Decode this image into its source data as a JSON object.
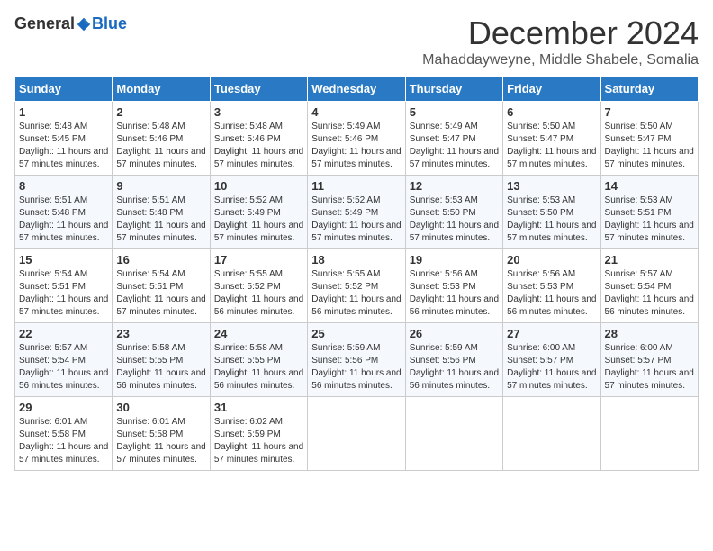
{
  "header": {
    "logo_general": "General",
    "logo_blue": "Blue",
    "month_title": "December 2024",
    "location": "Mahaddayweyne, Middle Shabele, Somalia"
  },
  "weekdays": [
    "Sunday",
    "Monday",
    "Tuesday",
    "Wednesday",
    "Thursday",
    "Friday",
    "Saturday"
  ],
  "weeks": [
    [
      {
        "day": "1",
        "sunrise": "5:48 AM",
        "sunset": "5:45 PM",
        "daylight": "11 hours and 57 minutes"
      },
      {
        "day": "2",
        "sunrise": "5:48 AM",
        "sunset": "5:46 PM",
        "daylight": "11 hours and 57 minutes"
      },
      {
        "day": "3",
        "sunrise": "5:48 AM",
        "sunset": "5:46 PM",
        "daylight": "11 hours and 57 minutes"
      },
      {
        "day": "4",
        "sunrise": "5:49 AM",
        "sunset": "5:46 PM",
        "daylight": "11 hours and 57 minutes"
      },
      {
        "day": "5",
        "sunrise": "5:49 AM",
        "sunset": "5:47 PM",
        "daylight": "11 hours and 57 minutes"
      },
      {
        "day": "6",
        "sunrise": "5:50 AM",
        "sunset": "5:47 PM",
        "daylight": "11 hours and 57 minutes"
      },
      {
        "day": "7",
        "sunrise": "5:50 AM",
        "sunset": "5:47 PM",
        "daylight": "11 hours and 57 minutes"
      }
    ],
    [
      {
        "day": "8",
        "sunrise": "5:51 AM",
        "sunset": "5:48 PM",
        "daylight": "11 hours and 57 minutes"
      },
      {
        "day": "9",
        "sunrise": "5:51 AM",
        "sunset": "5:48 PM",
        "daylight": "11 hours and 57 minutes"
      },
      {
        "day": "10",
        "sunrise": "5:52 AM",
        "sunset": "5:49 PM",
        "daylight": "11 hours and 57 minutes"
      },
      {
        "day": "11",
        "sunrise": "5:52 AM",
        "sunset": "5:49 PM",
        "daylight": "11 hours and 57 minutes"
      },
      {
        "day": "12",
        "sunrise": "5:53 AM",
        "sunset": "5:50 PM",
        "daylight": "11 hours and 57 minutes"
      },
      {
        "day": "13",
        "sunrise": "5:53 AM",
        "sunset": "5:50 PM",
        "daylight": "11 hours and 57 minutes"
      },
      {
        "day": "14",
        "sunrise": "5:53 AM",
        "sunset": "5:51 PM",
        "daylight": "11 hours and 57 minutes"
      }
    ],
    [
      {
        "day": "15",
        "sunrise": "5:54 AM",
        "sunset": "5:51 PM",
        "daylight": "11 hours and 57 minutes"
      },
      {
        "day": "16",
        "sunrise": "5:54 AM",
        "sunset": "5:51 PM",
        "daylight": "11 hours and 57 minutes"
      },
      {
        "day": "17",
        "sunrise": "5:55 AM",
        "sunset": "5:52 PM",
        "daylight": "11 hours and 56 minutes"
      },
      {
        "day": "18",
        "sunrise": "5:55 AM",
        "sunset": "5:52 PM",
        "daylight": "11 hours and 56 minutes"
      },
      {
        "day": "19",
        "sunrise": "5:56 AM",
        "sunset": "5:53 PM",
        "daylight": "11 hours and 56 minutes"
      },
      {
        "day": "20",
        "sunrise": "5:56 AM",
        "sunset": "5:53 PM",
        "daylight": "11 hours and 56 minutes"
      },
      {
        "day": "21",
        "sunrise": "5:57 AM",
        "sunset": "5:54 PM",
        "daylight": "11 hours and 56 minutes"
      }
    ],
    [
      {
        "day": "22",
        "sunrise": "5:57 AM",
        "sunset": "5:54 PM",
        "daylight": "11 hours and 56 minutes"
      },
      {
        "day": "23",
        "sunrise": "5:58 AM",
        "sunset": "5:55 PM",
        "daylight": "11 hours and 56 minutes"
      },
      {
        "day": "24",
        "sunrise": "5:58 AM",
        "sunset": "5:55 PM",
        "daylight": "11 hours and 56 minutes"
      },
      {
        "day": "25",
        "sunrise": "5:59 AM",
        "sunset": "5:56 PM",
        "daylight": "11 hours and 56 minutes"
      },
      {
        "day": "26",
        "sunrise": "5:59 AM",
        "sunset": "5:56 PM",
        "daylight": "11 hours and 56 minutes"
      },
      {
        "day": "27",
        "sunrise": "6:00 AM",
        "sunset": "5:57 PM",
        "daylight": "11 hours and 57 minutes"
      },
      {
        "day": "28",
        "sunrise": "6:00 AM",
        "sunset": "5:57 PM",
        "daylight": "11 hours and 57 minutes"
      }
    ],
    [
      {
        "day": "29",
        "sunrise": "6:01 AM",
        "sunset": "5:58 PM",
        "daylight": "11 hours and 57 minutes"
      },
      {
        "day": "30",
        "sunrise": "6:01 AM",
        "sunset": "5:58 PM",
        "daylight": "11 hours and 57 minutes"
      },
      {
        "day": "31",
        "sunrise": "6:02 AM",
        "sunset": "5:59 PM",
        "daylight": "11 hours and 57 minutes"
      },
      null,
      null,
      null,
      null
    ]
  ]
}
